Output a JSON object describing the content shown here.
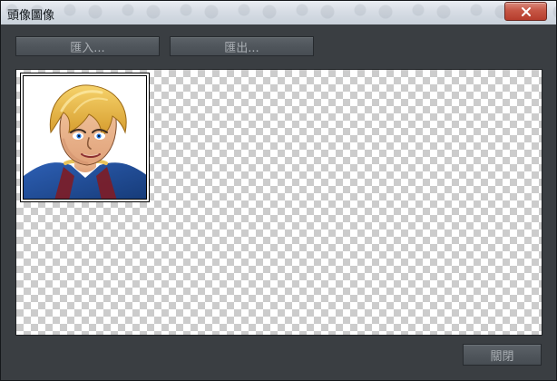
{
  "window": {
    "title": "頭像圖像",
    "close_icon": "close-icon"
  },
  "toolbar": {
    "import_label": "匯入...",
    "export_label": "匯出..."
  },
  "footer": {
    "close_label": "關閉"
  },
  "canvas": {
    "portrait_alt": "character-face-portrait"
  },
  "colors": {
    "window_bg": "#3a3e42",
    "title_bar": "#d7dde5",
    "close_button": "#c65645",
    "button_bg": "#4f555b",
    "button_text": "#a9aeb3",
    "checker_dark": "#cccccc",
    "checker_light": "#ffffff"
  }
}
